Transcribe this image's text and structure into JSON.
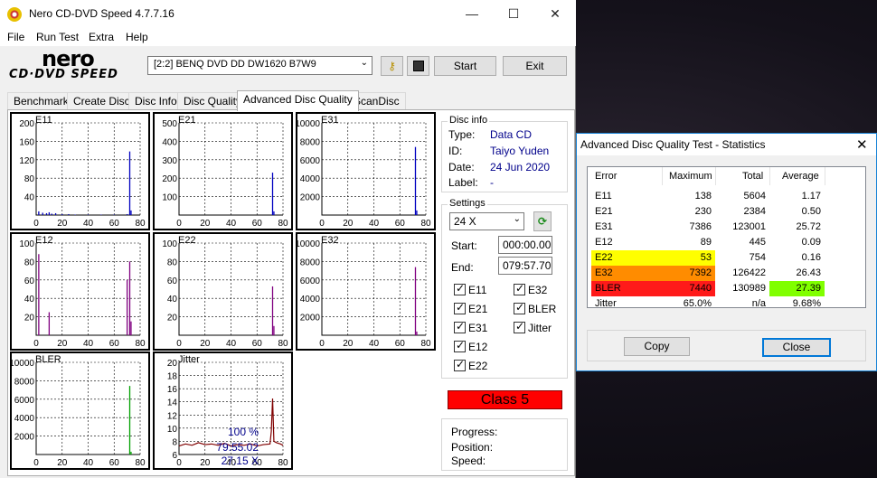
{
  "window": {
    "title": "Nero CD-DVD Speed 4.7.7.16",
    "minimize": "—",
    "maximize": "☐",
    "close": "✕"
  },
  "menu": [
    "File",
    "Run Test",
    "Extra",
    "Help"
  ],
  "logo": {
    "brand": "nero",
    "product": "CD·DVD SPEED"
  },
  "toolbar": {
    "drive": "[2:2]   BENQ DVD DD DW1620 B7W9",
    "start_label": "Start",
    "exit_label": "Exit"
  },
  "tabs": [
    "Benchmark",
    "Create Disc",
    "Disc Info",
    "Disc Quality",
    "Advanced Disc Quality",
    "ScanDisc"
  ],
  "active_tab": "Advanced Disc Quality",
  "charts": [
    {
      "name": "E11",
      "yticks": [
        "200",
        "160",
        "120",
        "80",
        "40"
      ],
      "xticks": [
        "0",
        "20",
        "40",
        "60",
        "80"
      ],
      "color": "#0000c0"
    },
    {
      "name": "E21",
      "yticks": [
        "500",
        "400",
        "300",
        "200",
        "100"
      ],
      "xticks": [
        "0",
        "20",
        "40",
        "60",
        "80"
      ],
      "color": "#0000c0"
    },
    {
      "name": "E31",
      "yticks": [
        "10000",
        "8000",
        "6000",
        "4000",
        "2000"
      ],
      "xticks": [
        "0",
        "20",
        "40",
        "60",
        "80"
      ],
      "color": "#0000c0"
    },
    {
      "name": "E12",
      "yticks": [
        "100",
        "80",
        "60",
        "40",
        "20"
      ],
      "xticks": [
        "0",
        "20",
        "40",
        "60",
        "80"
      ],
      "color": "#800080"
    },
    {
      "name": "E22",
      "yticks": [
        "100",
        "80",
        "60",
        "40",
        "20"
      ],
      "xticks": [
        "0",
        "20",
        "40",
        "60",
        "80"
      ],
      "color": "#800080"
    },
    {
      "name": "E32",
      "yticks": [
        "10000",
        "8000",
        "6000",
        "4000",
        "2000"
      ],
      "xticks": [
        "0",
        "20",
        "40",
        "60",
        "80"
      ],
      "color": "#800080"
    },
    {
      "name": "BLER",
      "yticks": [
        "10000",
        "8000",
        "6000",
        "4000",
        "2000"
      ],
      "xticks": [
        "0",
        "20",
        "40",
        "60",
        "80"
      ],
      "color": "#00a000"
    },
    {
      "name": "Jitter",
      "yticks": [
        "20",
        "18",
        "16",
        "14",
        "12",
        "10",
        "8",
        "6"
      ],
      "xticks": [
        "0",
        "20",
        "40",
        "60",
        "80"
      ],
      "color": "#800000"
    }
  ],
  "chart_data": [
    {
      "type": "bar",
      "title": "E11",
      "xlim": [
        0,
        80
      ],
      "ylim": [
        0,
        200
      ],
      "x": [
        2,
        5,
        8,
        10,
        12,
        15,
        20,
        25,
        30,
        40,
        50,
        60,
        70,
        72,
        73
      ],
      "values": [
        8,
        5,
        4,
        6,
        3,
        4,
        2,
        2,
        1,
        1,
        1,
        1,
        2,
        138,
        10
      ]
    },
    {
      "type": "bar",
      "title": "E21",
      "xlim": [
        0,
        80
      ],
      "ylim": [
        0,
        500
      ],
      "x": [
        72,
        73
      ],
      "values": [
        230,
        20
      ]
    },
    {
      "type": "bar",
      "title": "E31",
      "xlim": [
        0,
        80
      ],
      "ylim": [
        0,
        10000
      ],
      "x": [
        72,
        73
      ],
      "values": [
        7386,
        500
      ]
    },
    {
      "type": "bar",
      "title": "E12",
      "xlim": [
        0,
        80
      ],
      "ylim": [
        0,
        100
      ],
      "x": [
        2,
        10,
        70,
        72,
        73
      ],
      "values": [
        88,
        25,
        60,
        80,
        15
      ]
    },
    {
      "type": "bar",
      "title": "E22",
      "xlim": [
        0,
        80
      ],
      "ylim": [
        0,
        100
      ],
      "x": [
        72,
        73
      ],
      "values": [
        53,
        10
      ]
    },
    {
      "type": "bar",
      "title": "E32",
      "xlim": [
        0,
        80
      ],
      "ylim": [
        0,
        10000
      ],
      "x": [
        72,
        73
      ],
      "values": [
        7392,
        400
      ]
    },
    {
      "type": "bar",
      "title": "BLER",
      "xlim": [
        0,
        80
      ],
      "ylim": [
        0,
        10000
      ],
      "x": [
        72,
        73
      ],
      "values": [
        7440,
        300
      ]
    },
    {
      "type": "line",
      "title": "Jitter",
      "xlim": [
        0,
        80
      ],
      "ylim": [
        6,
        20
      ],
      "x": [
        0,
        5,
        10,
        15,
        20,
        25,
        30,
        35,
        40,
        45,
        50,
        55,
        60,
        65,
        70,
        71,
        72,
        73,
        75,
        78,
        80
      ],
      "values": [
        7.3,
        7.6,
        7.4,
        7.8,
        7.5,
        7.6,
        7.4,
        7.7,
        7.3,
        7.5,
        7.4,
        7.6,
        7.3,
        7.5,
        7.6,
        9.5,
        14.5,
        8.0,
        7.8,
        7.6,
        7.4
      ]
    }
  ],
  "disc_info": {
    "title": "Disc info",
    "rows": [
      {
        "label": "Type:",
        "value": "Data CD"
      },
      {
        "label": "ID:",
        "value": "Taiyo Yuden"
      },
      {
        "label": "Date:",
        "value": "24 Jun 2020"
      },
      {
        "label": "Label:",
        "value": "-"
      }
    ]
  },
  "settings": {
    "title": "Settings",
    "speed": "24 X",
    "start_label": "Start:",
    "start_value": "000:00.00",
    "end_label": "End:",
    "end_value": "079:57.70",
    "checks_left": [
      "E11",
      "E21",
      "E31",
      "E12",
      "E22"
    ],
    "checks_right": [
      "E32",
      "BLER",
      "Jitter"
    ]
  },
  "class_label": "Class 5",
  "progress": {
    "progress_label": "Progress:",
    "progress_value": "100 %",
    "position_label": "Position:",
    "position_value": "79:55.02",
    "speed_label": "Speed:",
    "speed_value": "27.15 X"
  },
  "stats": {
    "title": "Advanced Disc Quality Test - Statistics",
    "headers": [
      "Error",
      "Maximum",
      "Total",
      "Average"
    ],
    "rows": [
      {
        "error": "E11",
        "max": "138",
        "total": "5604",
        "avg": "1.17",
        "hl": "",
        "avg_hl": ""
      },
      {
        "error": "E21",
        "max": "230",
        "total": "2384",
        "avg": "0.50",
        "hl": "",
        "avg_hl": ""
      },
      {
        "error": "E31",
        "max": "7386",
        "total": "123001",
        "avg": "25.72",
        "hl": "",
        "avg_hl": ""
      },
      {
        "error": "E12",
        "max": "89",
        "total": "445",
        "avg": "0.09",
        "hl": "",
        "avg_hl": ""
      },
      {
        "error": "E22",
        "max": "53",
        "total": "754",
        "avg": "0.16",
        "hl": "#ffff00",
        "avg_hl": ""
      },
      {
        "error": "E32",
        "max": "7392",
        "total": "126422",
        "avg": "26.43",
        "hl": "#ff8c00",
        "avg_hl": ""
      },
      {
        "error": "BLER",
        "max": "7440",
        "total": "130989",
        "avg": "27.39",
        "hl": "#ff1a1a",
        "avg_hl": "#80ff00"
      },
      {
        "error": "Jitter",
        "max": "65.0%",
        "total": "n/a",
        "avg": "9.68%",
        "hl": "",
        "avg_hl": ""
      }
    ],
    "copy_label": "Copy",
    "close_label": "Close"
  }
}
